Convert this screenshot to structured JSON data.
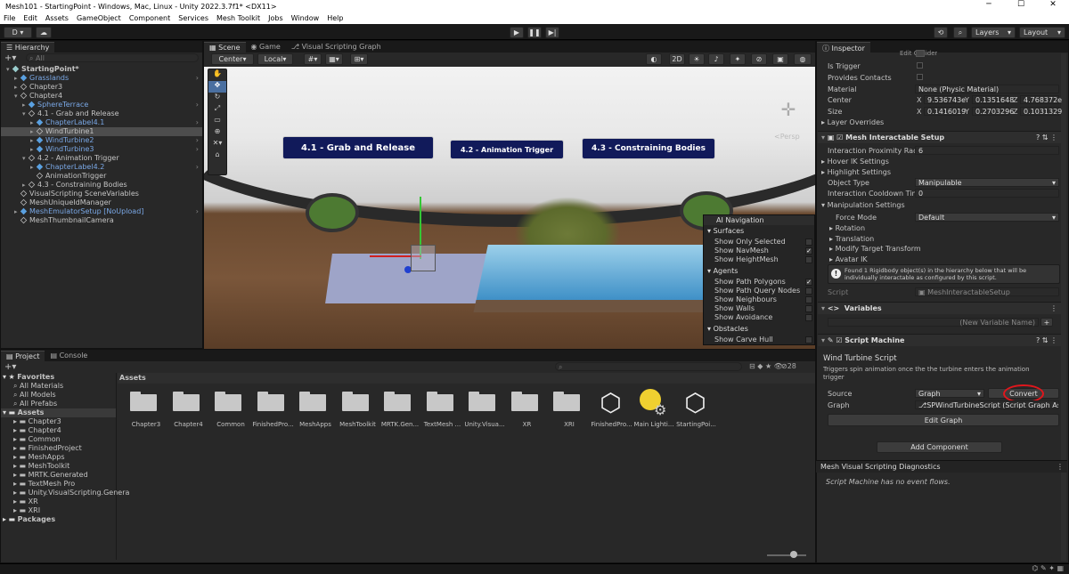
{
  "window": {
    "title": "Mesh101 - StartingPoint - Windows, Mac, Linux - Unity 2022.3.7f1* <DX11>",
    "min": "─",
    "max": "☐",
    "close": "✕"
  },
  "menu": [
    "File",
    "Edit",
    "Assets",
    "GameObject",
    "Component",
    "Services",
    "Mesh Toolkit",
    "Jobs",
    "Window",
    "Help"
  ],
  "toolbar": {
    "account": "D ▾",
    "layers": "Layers",
    "layout": "Layout"
  },
  "hierarchy": {
    "tab": "Hierarchy",
    "search_placeholder": "All",
    "items": [
      {
        "label": "StartingPoint*",
        "indent": 0,
        "type": "scene",
        "expanded": true
      },
      {
        "label": "Grasslands",
        "indent": 1,
        "type": "prefab",
        "expanded": false
      },
      {
        "label": "Chapter3",
        "indent": 1,
        "type": "go",
        "expanded": false
      },
      {
        "label": "Chapter4",
        "indent": 1,
        "type": "go",
        "expanded": true
      },
      {
        "label": "SphereTerrace",
        "indent": 2,
        "type": "prefab",
        "expanded": false
      },
      {
        "label": "4.1 - Grab and Release",
        "indent": 2,
        "type": "go",
        "expanded": true
      },
      {
        "label": "ChapterLabel4.1",
        "indent": 3,
        "type": "prefab",
        "expanded": false
      },
      {
        "label": "WindTurbine1",
        "indent": 3,
        "type": "go",
        "expanded": false,
        "selected": true
      },
      {
        "label": "WindTurbine2",
        "indent": 3,
        "type": "prefab",
        "expanded": false
      },
      {
        "label": "WindTurbine3",
        "indent": 3,
        "type": "prefab",
        "expanded": false
      },
      {
        "label": "4.2 - Animation Trigger",
        "indent": 2,
        "type": "go",
        "expanded": true
      },
      {
        "label": "ChapterLabel4.2",
        "indent": 3,
        "type": "prefab",
        "expanded": false
      },
      {
        "label": "AnimationTrigger",
        "indent": 3,
        "type": "go",
        "expanded": null
      },
      {
        "label": "4.3 - Constraining Bodies",
        "indent": 2,
        "type": "go",
        "expanded": false
      },
      {
        "label": "VisualScripting SceneVariables",
        "indent": 1,
        "type": "go",
        "expanded": null
      },
      {
        "label": "MeshUniqueIdManager",
        "indent": 1,
        "type": "go",
        "expanded": null
      },
      {
        "label": "MeshEmulatorSetup [NoUpload]",
        "indent": 1,
        "type": "prefab",
        "expanded": false
      },
      {
        "label": "MeshThumbnailCamera",
        "indent": 1,
        "type": "go",
        "expanded": null
      }
    ]
  },
  "scene": {
    "tabs": [
      "Scene",
      "Game",
      "Visual Scripting Graph"
    ],
    "pivot": "Center",
    "space": "Local",
    "mode2d": "2D",
    "persp": "<Persp",
    "labels": [
      "4.1 - Grab and Release",
      "4.2 - Animation Trigger",
      "4.3 - Constraining Bodies"
    ],
    "nav_overlay": {
      "title": "AI Navigation",
      "sections": [
        {
          "header": "Surfaces",
          "rows": [
            {
              "label": "Show Only Selected",
              "checked": false
            },
            {
              "label": "Show NavMesh",
              "checked": true
            },
            {
              "label": "Show HeightMesh",
              "checked": false
            }
          ]
        },
        {
          "header": "Agents",
          "rows": [
            {
              "label": "Show Path Polygons",
              "checked": true
            },
            {
              "label": "Show Path Query Nodes",
              "checked": false
            },
            {
              "label": "Show Neighbours",
              "checked": false
            },
            {
              "label": "Show Walls",
              "checked": false
            },
            {
              "label": "Show Avoidance",
              "checked": false
            }
          ]
        },
        {
          "header": "Obstacles",
          "rows": [
            {
              "label": "Show Carve Hull",
              "checked": false
            }
          ]
        }
      ]
    }
  },
  "project": {
    "tabs": [
      "Project",
      "Console"
    ],
    "count": "28",
    "breadcrumb": "Assets",
    "tree": [
      {
        "label": "Favorites",
        "indent": 0,
        "bold": true
      },
      {
        "label": "All Materials",
        "indent": 1
      },
      {
        "label": "All Models",
        "indent": 1
      },
      {
        "label": "All Prefabs",
        "indent": 1
      },
      {
        "label": "Assets",
        "indent": 0,
        "bold": true
      },
      {
        "label": "Chapter3",
        "indent": 1
      },
      {
        "label": "Chapter4",
        "indent": 1
      },
      {
        "label": "Common",
        "indent": 1
      },
      {
        "label": "FinishedProject",
        "indent": 1
      },
      {
        "label": "MeshApps",
        "indent": 1
      },
      {
        "label": "MeshToolkit",
        "indent": 1
      },
      {
        "label": "MRTK.Generated",
        "indent": 1
      },
      {
        "label": "TextMesh Pro",
        "indent": 1
      },
      {
        "label": "Unity.VisualScripting.Genera",
        "indent": 1
      },
      {
        "label": "XR",
        "indent": 1
      },
      {
        "label": "XRI",
        "indent": 1
      },
      {
        "label": "Packages",
        "indent": 0,
        "bold": true
      }
    ],
    "assets": [
      {
        "label": "Chapter3",
        "kind": "folder"
      },
      {
        "label": "Chapter4",
        "kind": "folder"
      },
      {
        "label": "Common",
        "kind": "folder"
      },
      {
        "label": "FinishedPro...",
        "kind": "folder"
      },
      {
        "label": "MeshApps",
        "kind": "folder"
      },
      {
        "label": "MeshToolkit",
        "kind": "folder"
      },
      {
        "label": "MRTK.Gen...",
        "kind": "folder"
      },
      {
        "label": "TextMesh ...",
        "kind": "folder"
      },
      {
        "label": "Unity.Visua...",
        "kind": "folder"
      },
      {
        "label": "XR",
        "kind": "folder"
      },
      {
        "label": "XRI",
        "kind": "folder"
      },
      {
        "label": "FinishedPro...",
        "kind": "unity"
      },
      {
        "label": "Main Lighti...",
        "kind": "light"
      },
      {
        "label": "StartingPoi...",
        "kind": "unity"
      }
    ]
  },
  "inspector": {
    "tab": "Inspector",
    "collider": {
      "edit_collider": "Edit Collider",
      "is_trigger": "Is Trigger",
      "provides_contacts": "Provides Contacts",
      "material_label": "Material",
      "material_value": "None (Physic Material)",
      "center_label": "Center",
      "center": {
        "x": "9.536743e",
        "y": "0.1351648",
        "z": "4.768372e"
      },
      "size_label": "Size",
      "size": {
        "x": "0.1416019",
        "y": "0.2703296",
        "z": "0.1031329"
      },
      "layer_overrides": "Layer Overrides"
    },
    "mesh_interactable": {
      "title": "Mesh Interactable Setup",
      "fields": [
        {
          "label": "Interaction Proximity Radius",
          "value": "6"
        },
        {
          "label": "Hover IK Settings",
          "value": ""
        },
        {
          "label": "Highlight Settings",
          "value": ""
        },
        {
          "label": "Object Type",
          "value": "Manipulable",
          "dropdown": true
        },
        {
          "label": "Interaction Cooldown Time",
          "value": "0"
        },
        {
          "label": "Manipulation Settings",
          "value": ""
        }
      ],
      "force_mode_label": "Force Mode",
      "force_mode": "Default",
      "subs": [
        "Rotation",
        "Translation",
        "Modify Target Transform",
        "Avatar IK"
      ],
      "info": "Found 1 Rigidbody object(s) in the hierarchy below that will be individually interactable as configured by this script.",
      "script_label": "Script",
      "script_value": "MeshInteractableSetup"
    },
    "variables": {
      "title": "Variables",
      "new_name": "(New Variable Name)",
      "add": "+"
    },
    "script_machine": {
      "title": "Script Machine",
      "name": "Wind Turbine Script",
      "description": "Triggers spin animation once the the turbine enters the animation trigger",
      "source_label": "Source",
      "source_value": "Graph",
      "convert": "Convert",
      "graph_label": "Graph",
      "graph_value": "SPWindTurbineScript (Script Graph Asse",
      "edit_graph": "Edit Graph"
    },
    "add_component": "Add Component",
    "diagnostics": {
      "title": "Mesh Visual Scripting Diagnostics",
      "message": "Script Machine has no event flows."
    }
  },
  "colors": {
    "accent": "#3a72b0",
    "highlight": "#e0161c",
    "selection": "#2c5d87"
  }
}
